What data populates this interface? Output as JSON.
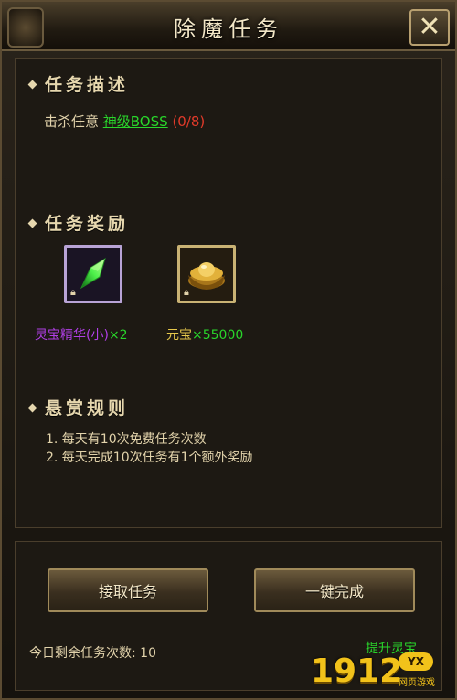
{
  "window": {
    "title": "除魔任务",
    "close_label": "✕"
  },
  "description": {
    "heading": "任务描述",
    "text_prefix": "击杀任意 ",
    "target": "神级BOSS",
    "progress": " (0/8)"
  },
  "rewards": {
    "heading": "任务奖励",
    "items": [
      {
        "name": "灵宝精华(小)",
        "mult": "×",
        "qty": "2",
        "icon": "green-crystal-icon",
        "color": "#b13fe7"
      },
      {
        "name": "元宝",
        "mult": "×",
        "qty": "55000",
        "icon": "gold-ingot-icon",
        "color": "#e6c84c"
      }
    ]
  },
  "rules": {
    "heading": "悬赏规则",
    "items": [
      "1. 每天有10次免费任务次数",
      "2. 每天完成10次任务有1个额外奖励"
    ]
  },
  "actions": {
    "accept_label": "接取任务",
    "complete_label": "一键完成"
  },
  "footer": {
    "remaining_label": "今日剩余任务次数: 10",
    "promo_text": "提升灵宝"
  },
  "watermark": {
    "digits": "1912",
    "badge": "YX",
    "sub": "网页游戏"
  }
}
